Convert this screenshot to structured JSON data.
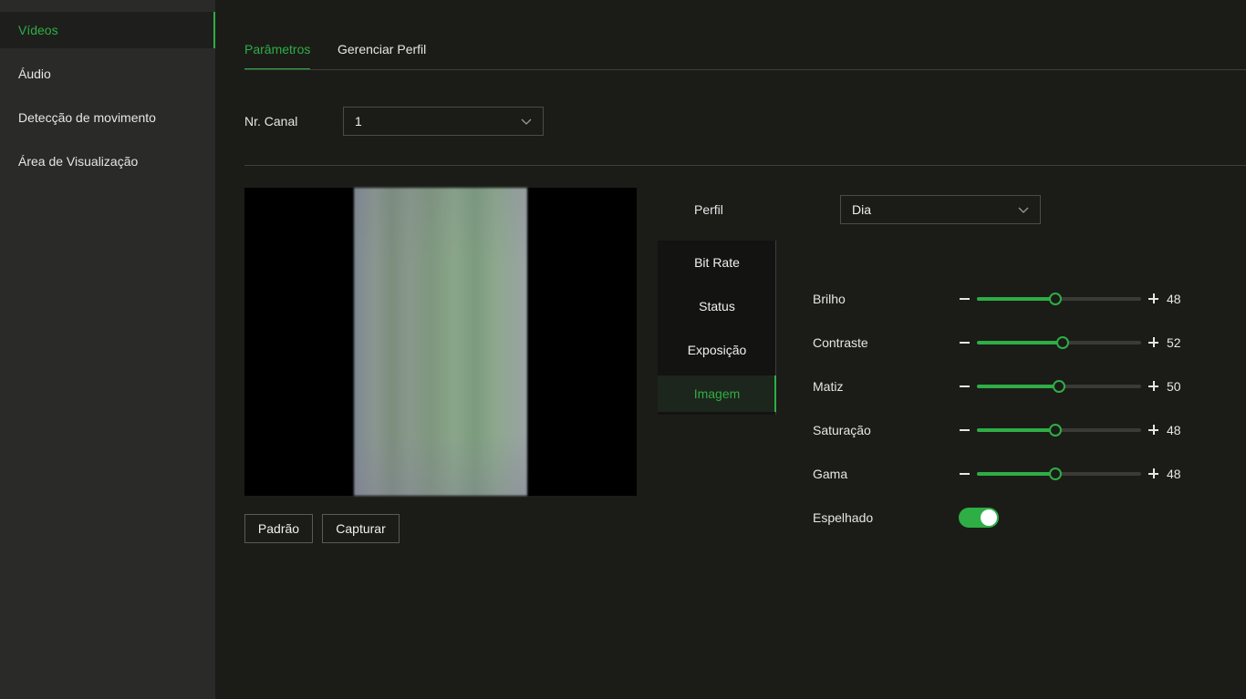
{
  "sidebar": {
    "items": [
      {
        "label": "Vídeos",
        "active": true
      },
      {
        "label": "Áudio"
      },
      {
        "label": "Detecção de movimento"
      },
      {
        "label": "Área de Visualização"
      }
    ]
  },
  "tabs": [
    {
      "label": "Parâmetros",
      "active": true
    },
    {
      "label": "Gerenciar Perfil"
    }
  ],
  "channel": {
    "label": "Nr. Canal",
    "value": "1"
  },
  "profile": {
    "label": "Perfil",
    "value": "Dia"
  },
  "buttons": {
    "default_label": "Padrão",
    "capture_label": "Capturar"
  },
  "submenu": [
    {
      "label": "Bit Rate"
    },
    {
      "label": "Status"
    },
    {
      "label": "Exposição"
    },
    {
      "label": "Imagem",
      "active": true
    }
  ],
  "sliders": [
    {
      "label": "Brilho",
      "value": 48,
      "value_text": "48",
      "fraction": 0.48
    },
    {
      "label": "Contraste",
      "value": 52,
      "value_text": "52",
      "fraction": 0.52
    },
    {
      "label": "Matiz",
      "value": 50,
      "value_text": "50",
      "fraction": 0.5
    },
    {
      "label": "Saturação",
      "value": 48,
      "value_text": "48",
      "fraction": 0.48
    },
    {
      "label": "Gama",
      "value": 48,
      "value_text": "48",
      "fraction": 0.48
    }
  ],
  "mirror": {
    "label": "Espelhado",
    "on": true
  },
  "icons": {
    "dropdown": "chevron-down-icon",
    "decrease": "minus-icon",
    "increase": "plus-icon"
  },
  "colors": {
    "accent": "#2eae45",
    "background": "#1b1c18",
    "sidebar": "#2a2b28"
  }
}
